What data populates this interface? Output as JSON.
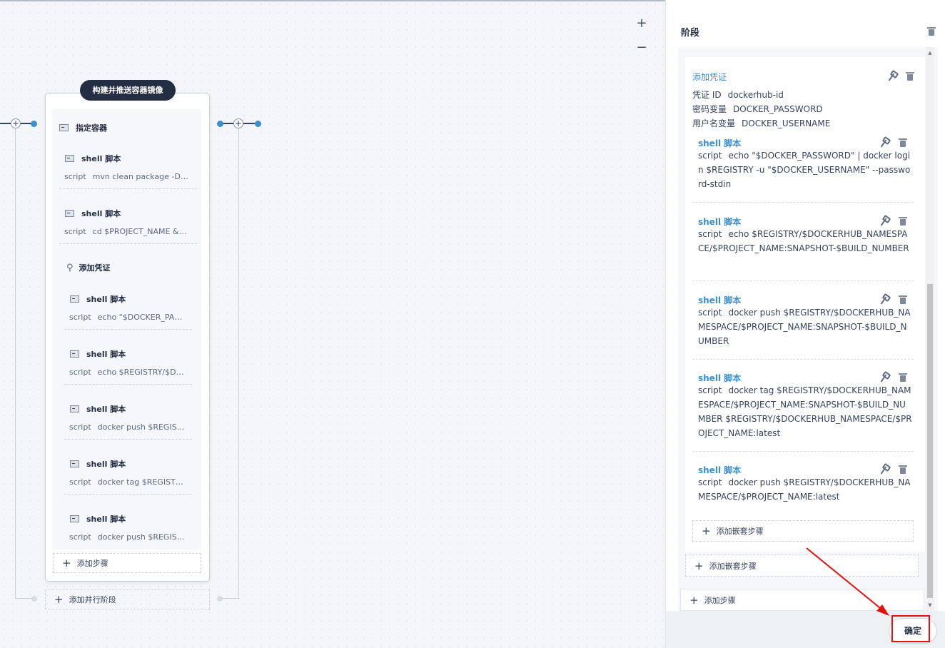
{
  "canvas": {
    "zoom_in": "+",
    "zoom_out": "−",
    "stage_title": "构建并推送容器镜像",
    "steps": [
      {
        "icon": "terminal-icon",
        "label": "指定容器"
      },
      {
        "icon": "terminal-icon",
        "label": "shell 脚本",
        "key": "script",
        "value": "mvn clean package -Dmaven.test.skip=true"
      },
      {
        "icon": "terminal-icon",
        "label": "shell 脚本",
        "key": "script",
        "value": "cd $PROJECT_NAME && docker build"
      },
      {
        "icon": "key-icon",
        "label": "添加凭证"
      },
      {
        "icon": "terminal-icon",
        "label": "shell 脚本",
        "key": "script",
        "value": "echo \"$DOCKER_PASSWORD\" | docker login"
      },
      {
        "icon": "terminal-icon",
        "label": "shell 脚本",
        "key": "script",
        "value": "echo $REGISTRY/$DOCKERHUB_NAMESPACE"
      },
      {
        "icon": "terminal-icon",
        "label": "shell 脚本",
        "key": "script",
        "value": "docker push $REGISTRY/$DOCKERHUB"
      },
      {
        "icon": "terminal-icon",
        "label": "shell 脚本",
        "key": "script",
        "value": "docker tag $REGISTRY/$DOCKERHUB"
      },
      {
        "icon": "terminal-icon",
        "label": "shell 脚本",
        "key": "script",
        "value": "docker push $REGISTRY/$DOCKERHUB"
      }
    ],
    "add_step": "添加步骤",
    "add_parallel_stage": "添加并行阶段"
  },
  "panel": {
    "title": "阶段",
    "credential": {
      "title": "添加凭证",
      "fields": [
        {
          "key": "凭证 ID",
          "value": "dockerhub-id"
        },
        {
          "key": "密码变量",
          "value": "DOCKER_PASSWORD"
        },
        {
          "key": "用户名变量",
          "value": "DOCKER_USERNAME"
        }
      ]
    },
    "nested_steps": [
      {
        "title": "shell 脚本",
        "key": "script",
        "value": "echo \"$DOCKER_PASSWORD\" | docker login $REGISTRY -u \"$DOCKER_USERNAME\" --password-stdin"
      },
      {
        "title": "shell 脚本",
        "key": "script",
        "value": "echo $REGISTRY/$DOCKERHUB_NAMESPACE/$PROJECT_NAME:SNAPSHOT-$BUILD_NUMBER"
      },
      {
        "title": "shell 脚本",
        "key": "script",
        "value": "docker push $REGISTRY/$DOCKERHUB_NAMESPACE/$PROJECT_NAME:SNAPSHOT-$BUILD_NUMBER"
      },
      {
        "title": "shell 脚本",
        "key": "script",
        "value": "docker tag $REGISTRY/$DOCKERHUB_NAMESPACE/$PROJECT_NAME:SNAPSHOT-$BUILD_NUMBER $REGISTRY/$DOCKERHUB_NAMESPACE/$PROJECT_NAME:latest"
      },
      {
        "title": "shell 脚本",
        "key": "script",
        "value": "docker push $REGISTRY/$DOCKERHUB_NAMESPACE/$PROJECT_NAME:latest"
      }
    ],
    "add_nested_step_inner": "添加嵌套步骤",
    "add_nested_step_outer": "添加嵌套步骤",
    "add_step": "添加步骤",
    "confirm": "确定"
  }
}
